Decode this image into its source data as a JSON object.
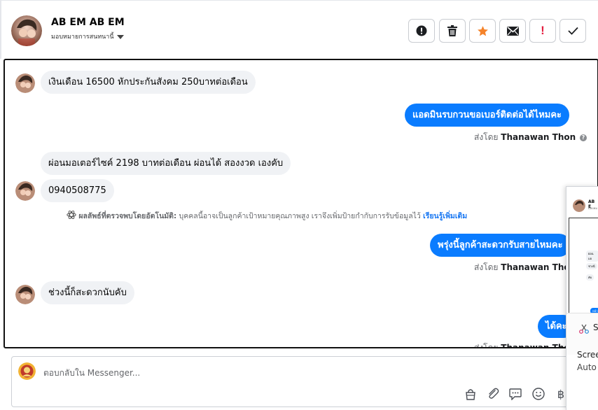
{
  "header": {
    "name": "AB EM AB EM",
    "assign_label": "มอบหมายการสนทนานี้",
    "toolbar": {
      "alert_icon": "exclamation-circle-icon",
      "delete_icon": "trash-icon",
      "star_icon": "star-icon",
      "email_icon": "envelope-icon",
      "spam_label": "!",
      "done_icon": "check-icon"
    }
  },
  "conversation": {
    "messages": [
      {
        "direction": "in",
        "text": "เงินเดือน 16500 หักประกันสังคม 250บาทต่อเดือน"
      },
      {
        "direction": "out",
        "text": "แอดมินรบกวนขอเบอร์ติดต่อได้ไหมคะ"
      },
      {
        "direction": "in",
        "text": "ผ่อนมอเตอร์ไซค์ 2198 บาทต่อเดือน ผ่อนได้ สองงวด เองคับ"
      },
      {
        "direction": "in",
        "text": "0940508775"
      },
      {
        "direction": "out",
        "text": "พรุ่งนี้ลูกค้าสะดวกรับสายไหมคะ"
      },
      {
        "direction": "in",
        "text": "ช่วงนี้ก็สะดวกนับคับ"
      },
      {
        "direction": "out",
        "text": "ได้คะ"
      }
    ],
    "sent_by_prefix": "ส่งโดย",
    "sent_by_name": "Thanawan Thon",
    "auto_detect": {
      "title": "ผลลัพธ์ที่ตรวจพบโดยอัตโนมัติ:",
      "body": "บุคคลนี้อาจเป็นลูกค้าเป้าหมายคุณภาพสูง เราจึงเพิ่มป้ายกำกับการรับข้อมูลไว้",
      "link": "เรียนรู้เพิ่มเติม"
    }
  },
  "overlay": {
    "name": "AB E",
    "subtitle": "มอบหม",
    "bubble1": "ผ่อนมอ",
    "bubble2": "ช่วงนี",
    "bubble3": "คับ",
    "bubble4": "หน้า",
    "snip_label": "S",
    "screen_label": "Scree",
    "auto_label": "Auto"
  },
  "composer": {
    "placeholder": "ตอบกลับใน Messenger...",
    "icons": [
      "shopping-bag-icon",
      "paperclip-icon",
      "chat-bubble-icon",
      "smiley-icon",
      "baht-icon"
    ],
    "baht_symbol": "฿"
  },
  "colors": {
    "accent": "#0a7cff",
    "incoming_bubble": "#f0f2f5",
    "star": "#f5832a",
    "spam": "#e41e3f"
  }
}
